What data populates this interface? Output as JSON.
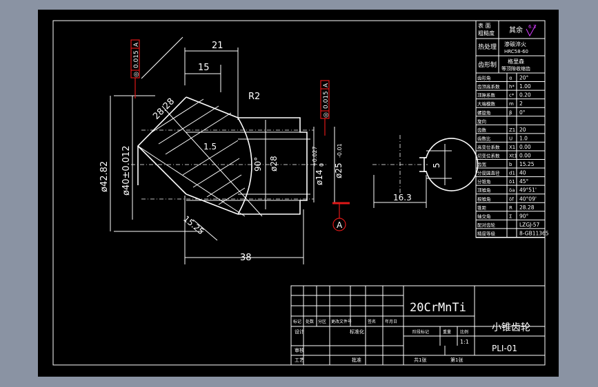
{
  "material": "20CrMnTi",
  "part_name": "小锥齿轮",
  "drawing_no": "PLI-01",
  "roughness": {
    "label_line1": "表 面",
    "label_line2": "粗糙度",
    "rest_label": "其余",
    "rest_value": "6.3"
  },
  "heat_treatment": {
    "label": "热处理",
    "value_line1": "渗碳淬火",
    "value_line2": "HRC58-60"
  },
  "gear_form": {
    "label": "齿形制",
    "value_line1": "格里森",
    "value_line2": "等顶隙收缩齿"
  },
  "params": [
    {
      "name": "齿形角",
      "symbol": "α",
      "value": "20°"
    },
    {
      "name": "齿顶高系数",
      "symbol": "h*",
      "value": "1.00"
    },
    {
      "name": "顶隙系数",
      "symbol": "c*",
      "value": "0.20"
    },
    {
      "name": "大端模数",
      "symbol": "m",
      "value": "2"
    },
    {
      "name": "螺旋角",
      "symbol": "β",
      "value": "0°"
    },
    {
      "name": "旋向",
      "symbol": "",
      "value": ""
    },
    {
      "name": "齿数",
      "symbol": "Z1",
      "value": "20"
    },
    {
      "name": "齿数比",
      "symbol": "U",
      "value": "1.0"
    },
    {
      "name": "高变位系数",
      "symbol": "X1",
      "value": "0.00"
    },
    {
      "name": "切变位系数",
      "symbol": "Xt1",
      "value": "0.00"
    },
    {
      "name": "齿宽",
      "symbol": "b",
      "value": "15.25"
    },
    {
      "name": "分度圆直径",
      "symbol": "d1",
      "value": "40"
    },
    {
      "name": "分锥角",
      "symbol": "δ1",
      "value": "45°"
    },
    {
      "name": "顶锥角",
      "symbol": "δa",
      "value": "49°51'"
    },
    {
      "name": "根锥角",
      "symbol": "δf",
      "value": "40°09'"
    },
    {
      "name": "锥距",
      "symbol": "R",
      "value": "28.28"
    },
    {
      "name": "轴交角",
      "symbol": "Σ",
      "value": "90°"
    },
    {
      "name": "配对齿轮",
      "symbol": "",
      "value": "LZGJ-57"
    },
    {
      "name": "精度等级",
      "symbol": "",
      "value": "8-GB11365"
    }
  ],
  "dimensions": {
    "d21": "21",
    "d15": "15",
    "r2": "R2",
    "d2828": "28.28",
    "d15b": "1.5",
    "d4282": "ø42.82",
    "d40": "ø40±0.012",
    "d90": "90°",
    "d28": "ø28",
    "d14": "ø14",
    "d14_tol_up": "+0.027",
    "d14_tol_low": "0",
    "d25": "ø25",
    "d25_tol": "-0.01",
    "d1525": "15.25",
    "d38": "38",
    "d163": "16.3",
    "d5": "5"
  },
  "gdt": [
    {
      "symbol": "◎",
      "value": "0.015",
      "datum": "A"
    },
    {
      "symbol": "◎",
      "value": "0.015",
      "datum": "A"
    }
  ],
  "datum_label": "A",
  "title_block": {
    "row_labels": [
      "标记",
      "处数",
      "分区",
      "更改文件号",
      "签名",
      "年月日"
    ],
    "design": "设计",
    "standardize": "标准化",
    "review": "审核",
    "process": "工艺",
    "approve": "批准",
    "stage_mark": "阶段标记",
    "weight": "重量",
    "scale": "比例",
    "scale_value": "1:1",
    "sheets_total": "共1张",
    "sheet_no": "第1张"
  }
}
